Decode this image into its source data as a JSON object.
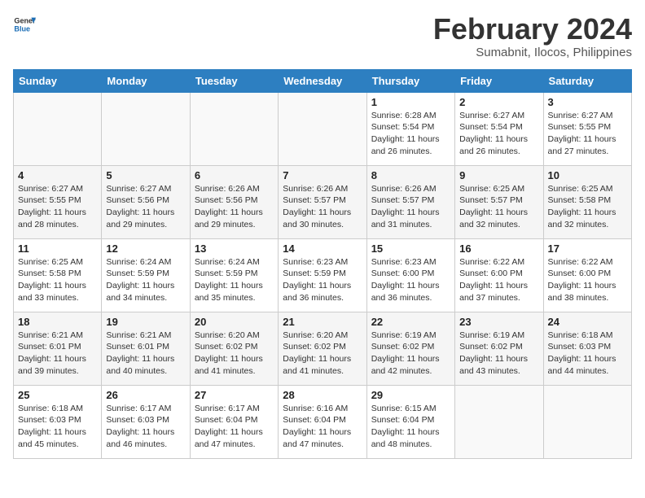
{
  "header": {
    "logo_general": "General",
    "logo_blue": "Blue",
    "month_year": "February 2024",
    "location": "Sumabnit, Ilocos, Philippines"
  },
  "days_of_week": [
    "Sunday",
    "Monday",
    "Tuesday",
    "Wednesday",
    "Thursday",
    "Friday",
    "Saturday"
  ],
  "weeks": [
    [
      {
        "day": "",
        "detail": ""
      },
      {
        "day": "",
        "detail": ""
      },
      {
        "day": "",
        "detail": ""
      },
      {
        "day": "",
        "detail": ""
      },
      {
        "day": "1",
        "detail": "Sunrise: 6:28 AM\nSunset: 5:54 PM\nDaylight: 11 hours and 26 minutes."
      },
      {
        "day": "2",
        "detail": "Sunrise: 6:27 AM\nSunset: 5:54 PM\nDaylight: 11 hours and 26 minutes."
      },
      {
        "day": "3",
        "detail": "Sunrise: 6:27 AM\nSunset: 5:55 PM\nDaylight: 11 hours and 27 minutes."
      }
    ],
    [
      {
        "day": "4",
        "detail": "Sunrise: 6:27 AM\nSunset: 5:55 PM\nDaylight: 11 hours and 28 minutes."
      },
      {
        "day": "5",
        "detail": "Sunrise: 6:27 AM\nSunset: 5:56 PM\nDaylight: 11 hours and 29 minutes."
      },
      {
        "day": "6",
        "detail": "Sunrise: 6:26 AM\nSunset: 5:56 PM\nDaylight: 11 hours and 29 minutes."
      },
      {
        "day": "7",
        "detail": "Sunrise: 6:26 AM\nSunset: 5:57 PM\nDaylight: 11 hours and 30 minutes."
      },
      {
        "day": "8",
        "detail": "Sunrise: 6:26 AM\nSunset: 5:57 PM\nDaylight: 11 hours and 31 minutes."
      },
      {
        "day": "9",
        "detail": "Sunrise: 6:25 AM\nSunset: 5:57 PM\nDaylight: 11 hours and 32 minutes."
      },
      {
        "day": "10",
        "detail": "Sunrise: 6:25 AM\nSunset: 5:58 PM\nDaylight: 11 hours and 32 minutes."
      }
    ],
    [
      {
        "day": "11",
        "detail": "Sunrise: 6:25 AM\nSunset: 5:58 PM\nDaylight: 11 hours and 33 minutes."
      },
      {
        "day": "12",
        "detail": "Sunrise: 6:24 AM\nSunset: 5:59 PM\nDaylight: 11 hours and 34 minutes."
      },
      {
        "day": "13",
        "detail": "Sunrise: 6:24 AM\nSunset: 5:59 PM\nDaylight: 11 hours and 35 minutes."
      },
      {
        "day": "14",
        "detail": "Sunrise: 6:23 AM\nSunset: 5:59 PM\nDaylight: 11 hours and 36 minutes."
      },
      {
        "day": "15",
        "detail": "Sunrise: 6:23 AM\nSunset: 6:00 PM\nDaylight: 11 hours and 36 minutes."
      },
      {
        "day": "16",
        "detail": "Sunrise: 6:22 AM\nSunset: 6:00 PM\nDaylight: 11 hours and 37 minutes."
      },
      {
        "day": "17",
        "detail": "Sunrise: 6:22 AM\nSunset: 6:00 PM\nDaylight: 11 hours and 38 minutes."
      }
    ],
    [
      {
        "day": "18",
        "detail": "Sunrise: 6:21 AM\nSunset: 6:01 PM\nDaylight: 11 hours and 39 minutes."
      },
      {
        "day": "19",
        "detail": "Sunrise: 6:21 AM\nSunset: 6:01 PM\nDaylight: 11 hours and 40 minutes."
      },
      {
        "day": "20",
        "detail": "Sunrise: 6:20 AM\nSunset: 6:02 PM\nDaylight: 11 hours and 41 minutes."
      },
      {
        "day": "21",
        "detail": "Sunrise: 6:20 AM\nSunset: 6:02 PM\nDaylight: 11 hours and 41 minutes."
      },
      {
        "day": "22",
        "detail": "Sunrise: 6:19 AM\nSunset: 6:02 PM\nDaylight: 11 hours and 42 minutes."
      },
      {
        "day": "23",
        "detail": "Sunrise: 6:19 AM\nSunset: 6:02 PM\nDaylight: 11 hours and 43 minutes."
      },
      {
        "day": "24",
        "detail": "Sunrise: 6:18 AM\nSunset: 6:03 PM\nDaylight: 11 hours and 44 minutes."
      }
    ],
    [
      {
        "day": "25",
        "detail": "Sunrise: 6:18 AM\nSunset: 6:03 PM\nDaylight: 11 hours and 45 minutes."
      },
      {
        "day": "26",
        "detail": "Sunrise: 6:17 AM\nSunset: 6:03 PM\nDaylight: 11 hours and 46 minutes."
      },
      {
        "day": "27",
        "detail": "Sunrise: 6:17 AM\nSunset: 6:04 PM\nDaylight: 11 hours and 47 minutes."
      },
      {
        "day": "28",
        "detail": "Sunrise: 6:16 AM\nSunset: 6:04 PM\nDaylight: 11 hours and 47 minutes."
      },
      {
        "day": "29",
        "detail": "Sunrise: 6:15 AM\nSunset: 6:04 PM\nDaylight: 11 hours and 48 minutes."
      },
      {
        "day": "",
        "detail": ""
      },
      {
        "day": "",
        "detail": ""
      }
    ]
  ]
}
